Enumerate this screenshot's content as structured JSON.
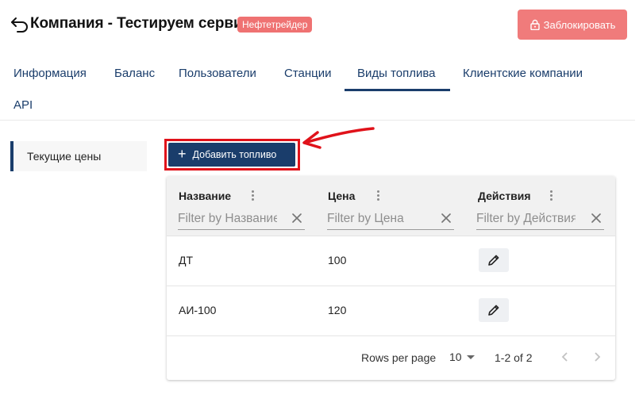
{
  "header": {
    "title": "Компания - Тестируем сервис",
    "badge": "Нефтетрейдер",
    "lock_button": "Заблокировать",
    "badge_color": "#ef7272",
    "lock_color": "#f07b7b"
  },
  "tabs": [
    {
      "label": "Информация"
    },
    {
      "label": "Баланс"
    },
    {
      "label": "Пользователи"
    },
    {
      "label": "Станции"
    },
    {
      "label": "Виды топлива",
      "active": true
    },
    {
      "label": "Клиентские компании"
    },
    {
      "label": "API"
    }
  ],
  "sidebar": {
    "items": [
      {
        "label": "Текущие цены",
        "active": true
      }
    ]
  },
  "toolbar": {
    "add_label": "Добавить топливо",
    "accent": "#1a3d6b",
    "highlight": "#e0121a"
  },
  "grid": {
    "columns": [
      {
        "title": "Название",
        "filter_placeholder": "Filter by Название"
      },
      {
        "title": "Цена",
        "filter_placeholder": "Filter by Цена"
      },
      {
        "title": "Действия",
        "filter_placeholder": "Filter by Действия"
      }
    ],
    "rows": [
      {
        "name": "ДТ",
        "price": "100"
      },
      {
        "name": "АИ-100",
        "price": "120"
      }
    ],
    "footer": {
      "rows_per_page_label": "Rows per page",
      "rows_per_page": "10",
      "range": "1-2 of 2"
    }
  }
}
